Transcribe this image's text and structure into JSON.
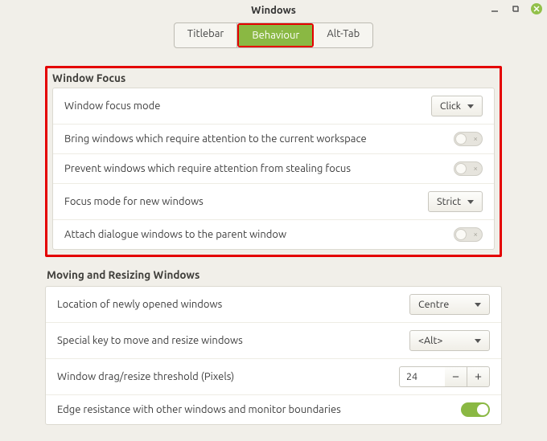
{
  "title": "Windows",
  "tabs": {
    "titlebar": "Titlebar",
    "behaviour": "Behaviour",
    "alttab": "Alt-Tab"
  },
  "focus": {
    "heading": "Window Focus",
    "rows": {
      "mode": {
        "label": "Window focus mode",
        "value": "Click"
      },
      "bring": {
        "label": "Bring windows which require attention to the current workspace"
      },
      "steal": {
        "label": "Prevent windows which require attention from stealing focus"
      },
      "newwin": {
        "label": "Focus mode for new windows",
        "value": "Strict"
      },
      "attach": {
        "label": "Attach dialogue windows to the parent window"
      }
    }
  },
  "move": {
    "heading": "Moving and Resizing Windows",
    "rows": {
      "location": {
        "label": "Location of newly opened windows",
        "value": "Centre"
      },
      "special": {
        "label": "Special key to move and resize windows",
        "value": "<Alt>"
      },
      "thresh": {
        "label": "Window drag/resize threshold (Pixels)",
        "value": "24"
      },
      "edge": {
        "label": "Edge resistance with other windows and monitor boundaries"
      }
    }
  }
}
